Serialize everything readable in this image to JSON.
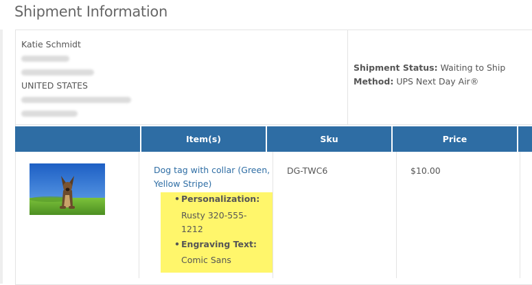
{
  "section_title": "Shipment Information",
  "address": {
    "name": "Katie Schmidt",
    "country": "UNITED STATES"
  },
  "shipment": {
    "status_label": "Shipment Status:",
    "status_value": "Waiting to Ship",
    "method_label": "Method:",
    "method_value": "UPS Next Day Air®"
  },
  "table": {
    "headers": [
      "",
      "Item(s)",
      "Sku",
      "Price",
      ""
    ],
    "row": {
      "image_icon": "dog-photo",
      "item_name": "Dog tag with collar (Green, Yellow Stripe)",
      "options": [
        {
          "label": "Personalization:",
          "value": "Rusty 320-555-1212"
        },
        {
          "label": "Engraving Text:",
          "value": "Comic Sans"
        }
      ],
      "sku": "DG-TWC6",
      "price": "$10.00"
    }
  },
  "colors": {
    "header_bg": "#2e6da4",
    "link": "#2e6da4",
    "highlight": "#fff66b"
  }
}
